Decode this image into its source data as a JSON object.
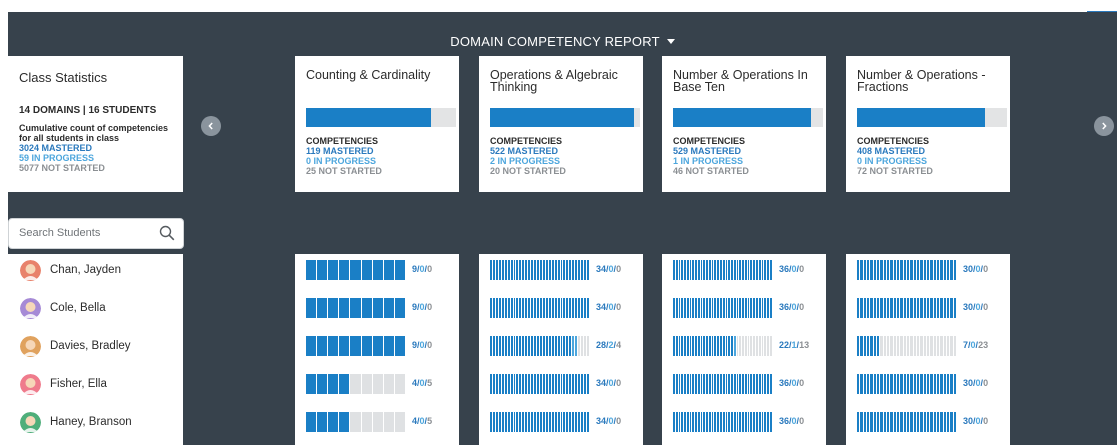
{
  "header": {
    "title": "DOMAIN COMPETENCY REPORT"
  },
  "stats": {
    "title": "Class Statistics",
    "summary": "14 DOMAINS | 16 STUDENTS",
    "description": "Cumulative count of competencies for all students in class",
    "mastered": "3024 MASTERED",
    "in_progress": "59 IN PROGRESS",
    "not_started": "5077 NOT STARTED"
  },
  "search": {
    "placeholder": "Search Students"
  },
  "colors": {
    "panel": "#37424c",
    "mastered": "#1a7fc6",
    "in_progress": "#4ca6dd",
    "not_started": "#dfe1e3",
    "nav": "#8a949d"
  },
  "icons": {
    "prev": "chevron-left-icon",
    "next": "chevron-right-icon",
    "search": "search-icon",
    "header_caret": "caret-down-icon"
  },
  "domains": [
    {
      "title": "Counting & Cardinality",
      "competencies_label": "COMPETENCIES",
      "mastered": "119 MASTERED",
      "in_progress": "0 IN PROGRESS",
      "not_started": "25 NOT STARTED",
      "mastered_fraction": 0.83
    },
    {
      "title": "Operations & Algebraic Thinking",
      "competencies_label": "COMPETENCIES",
      "mastered": "522 MASTERED",
      "in_progress": "2 IN PROGRESS",
      "not_started": "20 NOT STARTED",
      "mastered_fraction": 0.96
    },
    {
      "title": "Number & Operations In Base Ten",
      "competencies_label": "COMPETENCIES",
      "mastered": "529 MASTERED",
      "in_progress": "1 IN PROGRESS",
      "not_started": "46 NOT STARTED",
      "mastered_fraction": 0.92
    },
    {
      "title": "Number & Operations - Fractions",
      "competencies_label": "COMPETENCIES",
      "mastered": "408 MASTERED",
      "in_progress": "0 IN PROGRESS",
      "not_started": "72 NOT STARTED",
      "mastered_fraction": 0.85
    }
  ],
  "students": [
    {
      "name": "Chan, Jayden",
      "avatar_color": "#e8826b",
      "progress": [
        {
          "m": 9,
          "p": 0,
          "n": 0
        },
        {
          "m": 34,
          "p": 0,
          "n": 0
        },
        {
          "m": 36,
          "p": 0,
          "n": 0
        },
        {
          "m": 30,
          "p": 0,
          "n": 0
        }
      ]
    },
    {
      "name": "Cole, Bella",
      "avatar_color": "#a68ad6",
      "progress": [
        {
          "m": 9,
          "p": 0,
          "n": 0
        },
        {
          "m": 34,
          "p": 0,
          "n": 0
        },
        {
          "m": 36,
          "p": 0,
          "n": 0
        },
        {
          "m": 30,
          "p": 0,
          "n": 0
        }
      ]
    },
    {
      "name": "Davies, Bradley",
      "avatar_color": "#e0a25e",
      "progress": [
        {
          "m": 9,
          "p": 0,
          "n": 0
        },
        {
          "m": 28,
          "p": 2,
          "n": 4
        },
        {
          "m": 22,
          "p": 1,
          "n": 13
        },
        {
          "m": 7,
          "p": 0,
          "n": 23
        }
      ]
    },
    {
      "name": "Fisher, Ella",
      "avatar_color": "#ef7b8c",
      "progress": [
        {
          "m": 4,
          "p": 0,
          "n": 5
        },
        {
          "m": 34,
          "p": 0,
          "n": 0
        },
        {
          "m": 36,
          "p": 0,
          "n": 0
        },
        {
          "m": 30,
          "p": 0,
          "n": 0
        }
      ]
    },
    {
      "name": "Haney, Branson",
      "avatar_color": "#4fae7a",
      "progress": [
        {
          "m": 4,
          "p": 0,
          "n": 5
        },
        {
          "m": 34,
          "p": 0,
          "n": 0
        },
        {
          "m": 36,
          "p": 0,
          "n": 0
        },
        {
          "m": 30,
          "p": 0,
          "n": 0
        }
      ]
    }
  ]
}
